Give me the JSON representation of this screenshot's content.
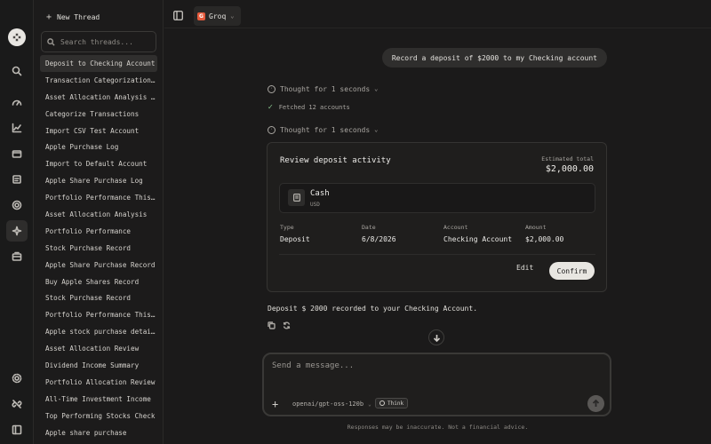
{
  "sidebar": {
    "new_thread_label": "New Thread",
    "search_placeholder": "Search threads...",
    "threads": [
      "Deposit to Checking Account",
      "Transaction Categorization ...",
      "Asset Allocation Analysis R...",
      "Categorize Transactions",
      "Import CSV Test Account",
      "Apple Purchase Log",
      "Import to Default Account",
      "Apple Share Purchase Log",
      "Portfolio Performance This ...",
      "Asset Allocation Analysis",
      "Portfolio Performance",
      "Stock Purchase Record",
      "Apple Share Purchase Record",
      "Buy Apple Shares Record",
      "Stock Purchase Record",
      "Portfolio Performance This ...",
      "Apple stock purchase details",
      "Asset Allocation Review",
      "Dividend Income Summary",
      "Portfolio Allocation Review",
      "All-Time Investment Income",
      "Top Performing Stocks Check",
      "Apple share purchase"
    ],
    "active_index": 0
  },
  "topbar": {
    "model_provider": "Groq",
    "provider_logo_letter": "G"
  },
  "chat": {
    "user_message": "Record a deposit of $2000 to my Checking account",
    "thought_1": "Thought for 1 seconds",
    "fetched_text": "Fetched 12 accounts",
    "thought_2": "Thought for 1 seconds",
    "result_text": "Deposit $ 2000 recorded to your Checking Account."
  },
  "card": {
    "title": "Review deposit activity",
    "estimated_total_label": "Estimated total",
    "estimated_total_value": "$2,000.00",
    "asset_name": "Cash",
    "asset_currency": "USD",
    "fields": {
      "type_label": "Type",
      "type_value": "Deposit",
      "date_label": "Date",
      "date_value": "6/8/2026",
      "account_label": "Account",
      "account_value": "Checking Account",
      "amount_label": "Amount",
      "amount_value": "$2,000.00"
    },
    "edit_label": "Edit",
    "confirm_label": "Confirm"
  },
  "composer": {
    "placeholder": "Send a message...",
    "model_name": "openai/gpt-oss-120b",
    "think_label": "Think",
    "disclaimer": "Responses may be inaccurate. Not a financial advice."
  },
  "colors": {
    "background": "#1b1a1a",
    "provider_accent": "#e55a3c",
    "confirm_button": "#e8e6e1",
    "success_check": "#8bc58e"
  }
}
